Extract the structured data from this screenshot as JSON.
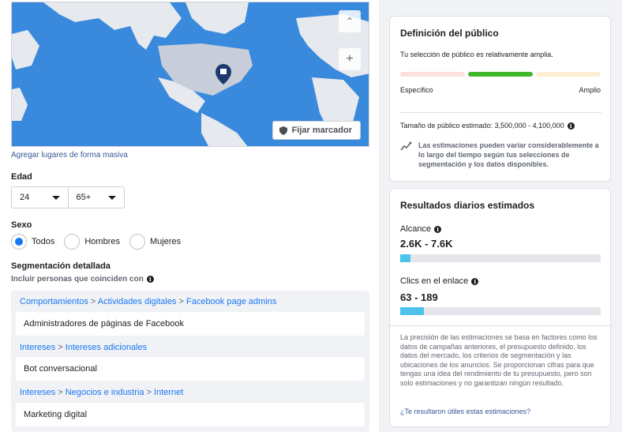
{
  "map": {
    "pin_button_label": "Fijar marcador",
    "zoom_in": "+",
    "collapse": "^"
  },
  "bulk_locations_link": "Agregar lugares de forma masiva",
  "age": {
    "label": "Edad",
    "min": "24",
    "max": "65+"
  },
  "gender": {
    "label": "Sexo",
    "options": [
      {
        "label": "Todos",
        "selected": true
      },
      {
        "label": "Hombres",
        "selected": false
      },
      {
        "label": "Mujeres",
        "selected": false
      }
    ]
  },
  "detailed_targeting": {
    "label": "Segmentación detallada",
    "include_label": "Incluir personas que coinciden con",
    "groups": [
      {
        "path": [
          "Comportamientos",
          "Actividades digitales",
          "Facebook page admins"
        ],
        "item": "Administradores de páginas de Facebook"
      },
      {
        "path": [
          "Intereses",
          "Intereses adicionales"
        ],
        "item": "Bot conversacional"
      },
      {
        "path": [
          "Intereses",
          "Negocios e industria",
          "Internet"
        ],
        "item": "Marketing digital"
      }
    ]
  },
  "audience_definition": {
    "title": "Definición del público",
    "subtitle": "Tu selección de público es relativamente amplia.",
    "left_label": "Específico",
    "right_label": "Amplio",
    "size_text": "Tamaño de público estimado: 3,500,000 - 4,100,000",
    "note": "Las estimaciones pueden variar considerablemente a lo largo del tiempo según tus selecciones de segmentación y los datos disponibles."
  },
  "daily_results": {
    "title": "Resultados diarios estimados",
    "reach_label": "Alcance",
    "reach_value": "2.6K - 7.6K",
    "reach_progress": 0.05,
    "clicks_label": "Clics en el enlace",
    "clicks_value": "63 - 189",
    "clicks_progress": 0.12,
    "disclaimer": "La precisión de las estimaciones se basa en factores como los datos de campañas anteriores, el presupuesto definido, los datos del mercado, los criterios de segmentación y las ubicaciones de los anuncios. Se proporcionan cifras para que tengas una idea del rendimiento de tu presupuesto, pero son solo estimaciones y no garantizan ningún resultado.",
    "feedback_link": "¿Te resultaron útiles estas estimaciones?"
  },
  "colors": {
    "accent": "#1877f2",
    "bar_active": "#42b72a",
    "bar_left": "#fbe0dc",
    "bar_right": "#fdefd1",
    "progress_fill": "#4cc3eb"
  }
}
